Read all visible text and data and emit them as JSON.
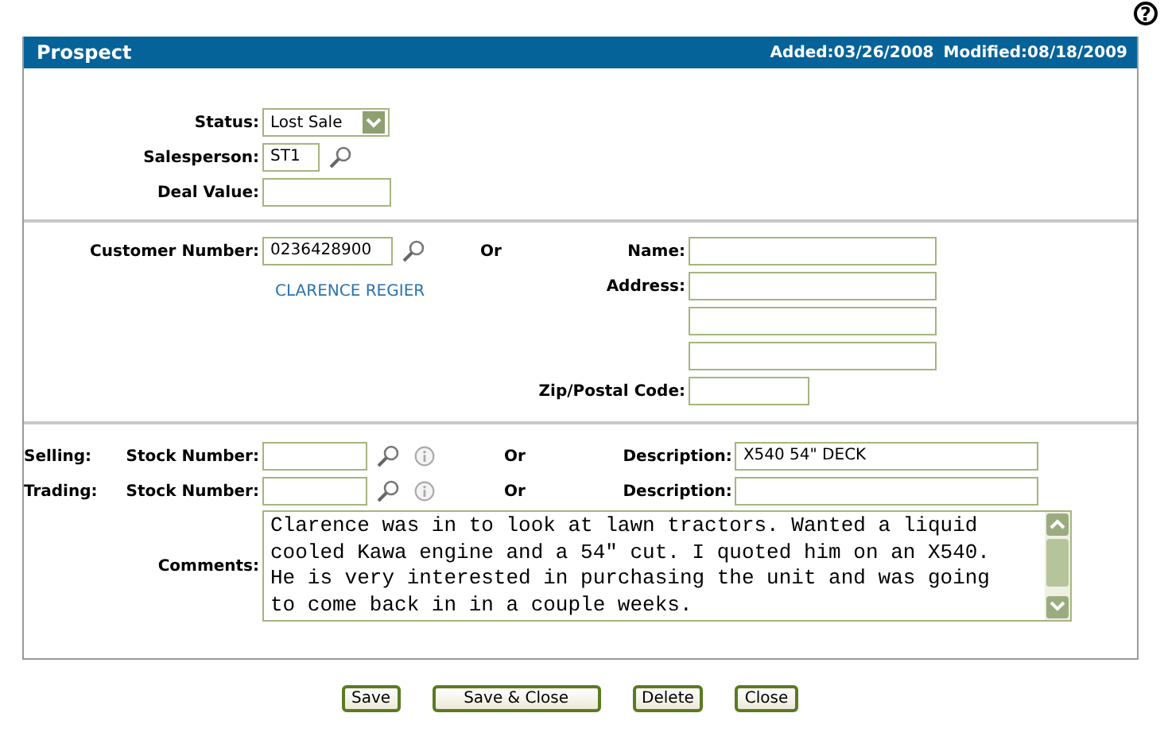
{
  "help": "?",
  "header": {
    "title": "Prospect",
    "added": "Added:03/26/2008",
    "modified": "Modified:08/18/2009"
  },
  "general": [
    {
      "label": "Status:",
      "kind": "select",
      "value": "Lost Sale"
    },
    {
      "label": "Salesperson:",
      "kind": "lookup",
      "value": "ST1"
    },
    {
      "label": "Deal Value:",
      "kind": "text"
    }
  ],
  "customer": {
    "number_label": "Customer Number:",
    "number": "0236428900",
    "name_link": "CLARENCE REGIER",
    "or": "Or",
    "name_label": "Name:",
    "address_label": "Address:",
    "zip_label": "Zip/Postal Code:"
  },
  "units": [
    {
      "group": "Selling:",
      "label": "Stock Number:",
      "or": "Or",
      "description_label": "Description:",
      "description": "X540 54\" DECK"
    },
    {
      "group": "Trading:",
      "label": "Stock Number:",
      "or": "Or",
      "description_label": "Description:"
    }
  ],
  "comments": {
    "label": "Comments:",
    "value": "Clarence was in to look at lawn tractors. Wanted a liquid cooled Kawa engine and a 54\" cut. I quoted him on an X540. He is very interested in purchasing the unit and was going to come back in in a couple weeks."
  },
  "buttons": [
    {
      "label": "Save"
    },
    {
      "label": "Save & Close"
    },
    {
      "label": "Delete"
    },
    {
      "label": "Close"
    }
  ]
}
